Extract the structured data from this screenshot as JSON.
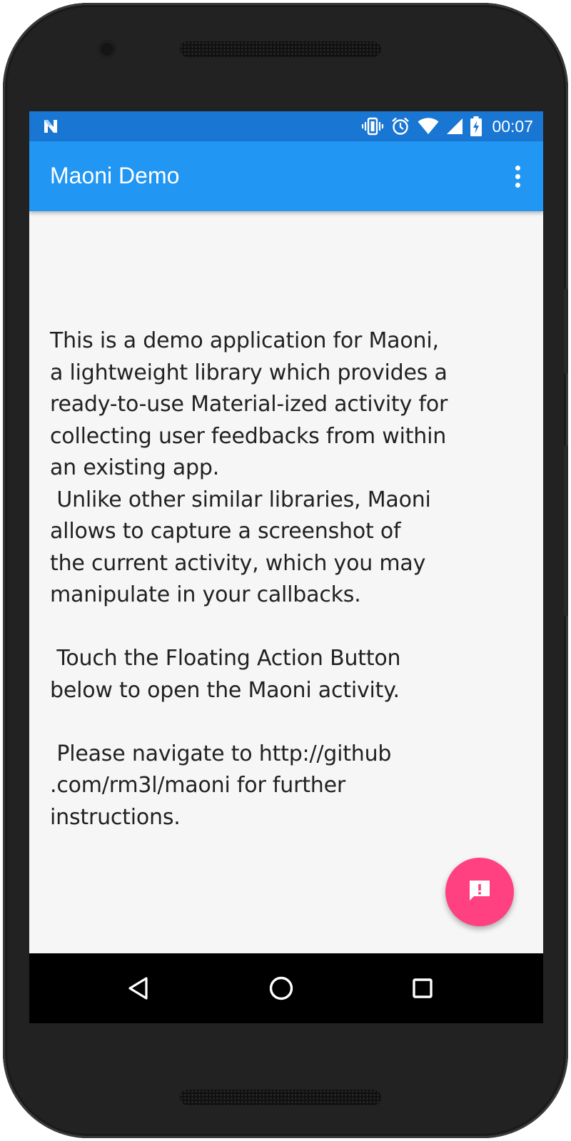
{
  "device": {
    "name": "android-phone"
  },
  "status_bar": {
    "notification_icon": "n-icon",
    "icons": [
      "vibrate-icon",
      "alarm-icon",
      "wifi-icon",
      "cell-signal-icon",
      "battery-charging-icon"
    ],
    "time": "00:07"
  },
  "app_bar": {
    "title": "Maoni Demo",
    "overflow_icon": "more-vert-icon"
  },
  "main": {
    "body_text": "This is a demo application for Maoni,\na lightweight library which provides a\nready-to-use Material-ized activity for\ncollecting user feedbacks from within\nan existing app.\n Unlike other similar libraries, Maoni\nallows to capture a screenshot of\nthe current activity, which you may\nmanipulate in your callbacks.\n\n Touch the Floating Action Button\nbelow to open the Maoni activity.\n\n Please navigate to http://github\n.com/rm3l/maoni for further\ninstructions."
  },
  "fab": {
    "icon": "feedback-icon",
    "color": "#ff4081"
  },
  "nav_bar": {
    "buttons": [
      "back-icon",
      "home-icon",
      "recents-icon"
    ]
  },
  "colors": {
    "primary": "#2196f3",
    "primary_dark": "#1976d2",
    "accent": "#ff4081",
    "background": "#f6f6f6"
  }
}
